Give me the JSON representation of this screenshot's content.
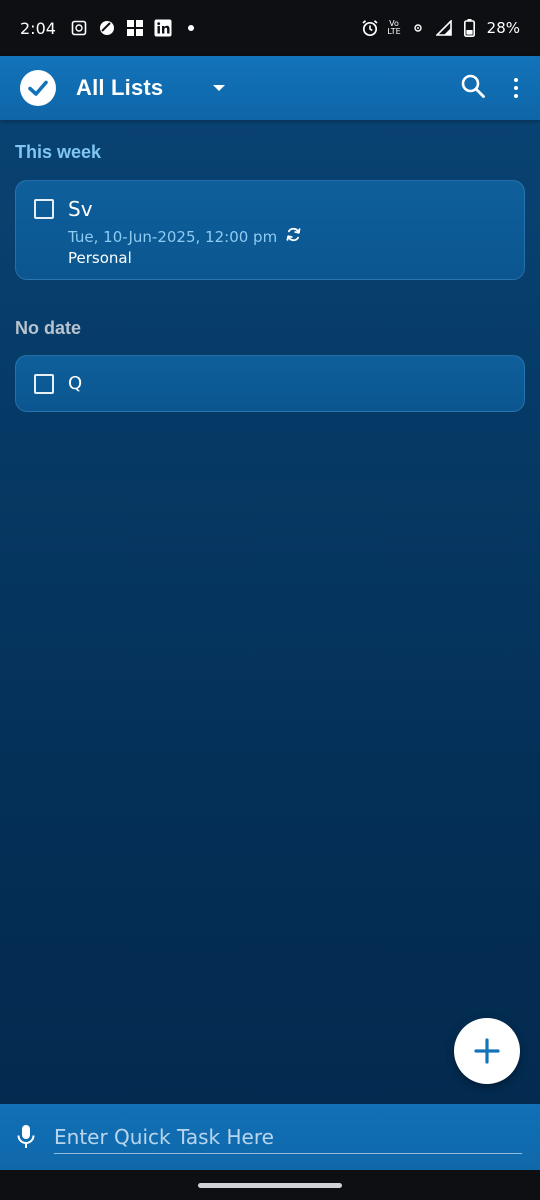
{
  "status_bar": {
    "time": "2:04",
    "battery": "28%",
    "volte_top": "Vo",
    "volte_bottom": "LTE"
  },
  "app_bar": {
    "title": "All Lists",
    "icons": [
      "check-circle-logo",
      "dropdown-caret",
      "search-icon",
      "more-vert-icon"
    ]
  },
  "sections": [
    {
      "header": "This week",
      "tasks": [
        {
          "title": "Sv",
          "due": "Tue, 10-Jun-2025, 12:00 pm",
          "repeat": true,
          "list": "Personal"
        }
      ]
    },
    {
      "header": "No date",
      "tasks": [
        {
          "title": "Q"
        }
      ]
    }
  ],
  "quick_task": {
    "placeholder": "Enter Quick Task Here"
  },
  "colors": {
    "accent": "#1373ba",
    "section_this_week": "#7fc6f2",
    "section_no_date": "#b9c3cf",
    "date_text": "#8ecbf3"
  }
}
